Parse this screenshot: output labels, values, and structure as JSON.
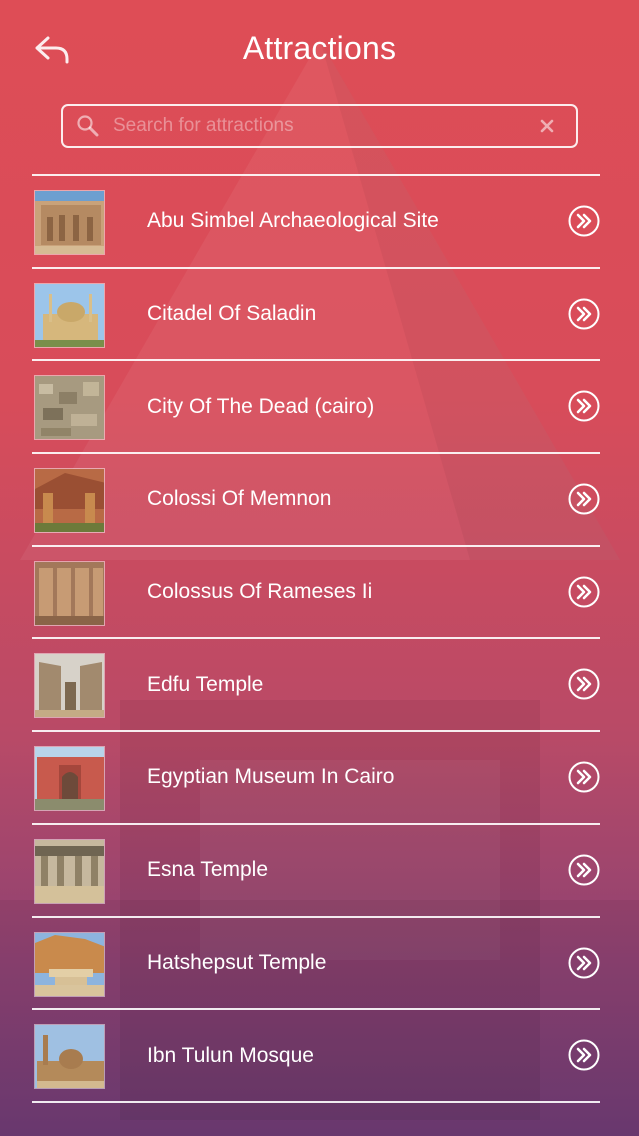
{
  "header": {
    "title": "Attractions"
  },
  "search": {
    "placeholder": "Search for attractions",
    "value": ""
  },
  "attractions": [
    {
      "label": "Abu Simbel Archaeological Site"
    },
    {
      "label": "Citadel Of Saladin"
    },
    {
      "label": "City Of The Dead (cairo)"
    },
    {
      "label": "Colossi Of Memnon"
    },
    {
      "label": "Colossus Of Rameses Ii"
    },
    {
      "label": "Edfu Temple"
    },
    {
      "label": "Egyptian Museum In Cairo"
    },
    {
      "label": "Esna Temple"
    },
    {
      "label": "Hatshepsut Temple"
    },
    {
      "label": "Ibn Tulun Mosque"
    }
  ],
  "icons": {
    "back": "back-arrow-icon",
    "search": "search-icon",
    "clear": "close-icon",
    "row_action": "double-chevron-right-icon"
  },
  "colors": {
    "gradient_top": "#de4d56",
    "gradient_bottom": "#6e3c74",
    "foreground": "#ffffff"
  }
}
